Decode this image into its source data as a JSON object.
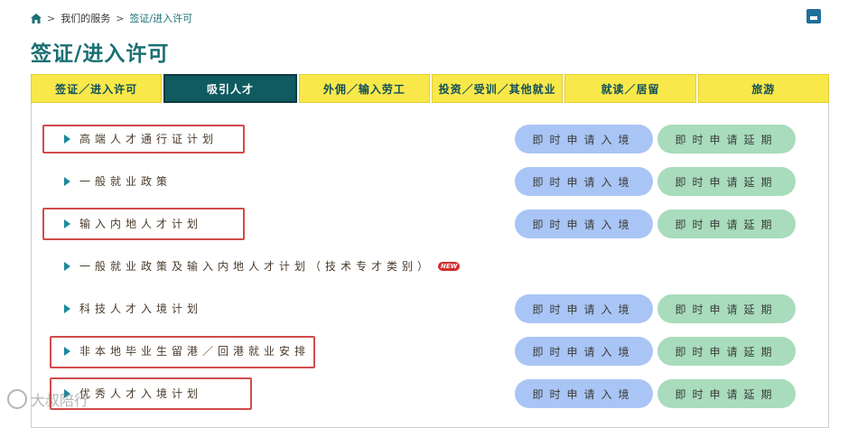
{
  "breadcrumb": {
    "level1": "我们的服务",
    "level2": "签证/进入许可"
  },
  "page_title": "签证/进入许可",
  "tabs": [
    {
      "label": "签证／进入许可"
    },
    {
      "label": "吸引人才"
    },
    {
      "label": "外佣／输入劳工"
    },
    {
      "label": "投资／受训／其他就业"
    },
    {
      "label": "就读／居留"
    },
    {
      "label": "旅游"
    }
  ],
  "items": [
    {
      "label": "高端人才通行证计划"
    },
    {
      "label": "一般就业政策"
    },
    {
      "label": "输入内地人才计划"
    },
    {
      "label": "一般就业政策及输入内地人才计划（技术专才类别）"
    },
    {
      "label": "科技人才入境计划"
    },
    {
      "label": "非本地毕业生留港／回港就业安排"
    },
    {
      "label": "优秀人才入境计划"
    }
  ],
  "badge": {
    "new": "NEW"
  },
  "buttons": {
    "enter": "即时申请入境",
    "extend": "即时申请延期"
  },
  "watermark": {
    "text": "大叔陪行"
  }
}
